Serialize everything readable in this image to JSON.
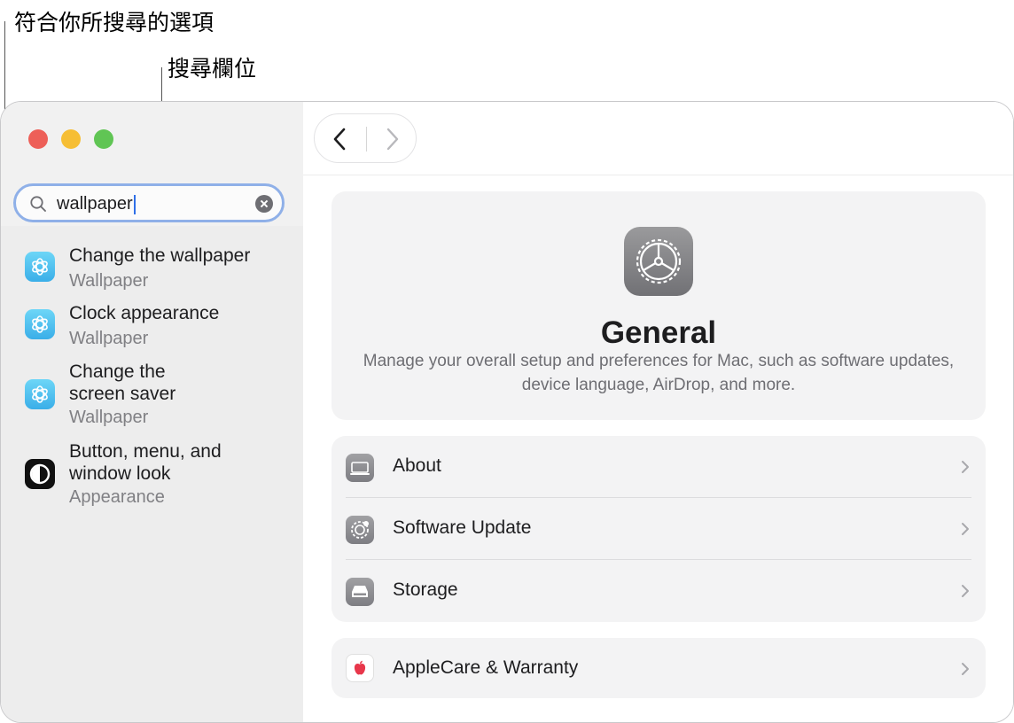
{
  "callouts": {
    "matching_results": "符合你所搜尋的選項",
    "search_field": "搜尋欄位"
  },
  "search": {
    "value": "wallpaper"
  },
  "results": [
    {
      "title_lines": [
        "Change the wallpaper"
      ],
      "subtitle": "Wallpaper",
      "icon": "wallpaper-flower-icon"
    },
    {
      "title_lines": [
        "Clock appearance"
      ],
      "subtitle": "Wallpaper",
      "icon": "wallpaper-flower-icon"
    },
    {
      "title_lines": [
        "Change the",
        "screen saver"
      ],
      "subtitle": "Wallpaper",
      "icon": "wallpaper-flower-icon"
    },
    {
      "title_lines": [
        "Button, menu, and",
        "window look"
      ],
      "subtitle": "Appearance",
      "icon": "appearance-icon"
    }
  ],
  "general": {
    "title": "General",
    "description_lines": [
      "Manage your overall setup and preferences for Mac, such as software updates,",
      "device language, AirDrop, and more."
    ]
  },
  "rows": [
    {
      "label": "About",
      "icon": "laptop-icon"
    },
    {
      "label": "Software Update",
      "icon": "software-update-gear-icon"
    },
    {
      "label": "Storage",
      "icon": "storage-drive-icon"
    }
  ],
  "applecare": {
    "label": "AppleCare & Warranty",
    "icon": "apple-logo-icon"
  },
  "colors": {
    "search_focus_ring": "#8fb0e8",
    "traffic_red": "#ed5f58",
    "traffic_yellow": "#f6be34",
    "traffic_green": "#60c554",
    "wallpaper_icon": "#4cbfee",
    "applecare_apple": "#e8374b"
  }
}
